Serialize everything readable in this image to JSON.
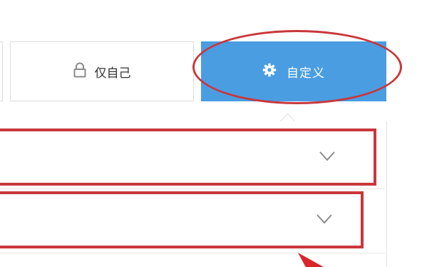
{
  "visibility": {
    "only_me": {
      "label": "仅自己",
      "icon": "lock-icon"
    },
    "custom": {
      "label": "自定义",
      "icon": "gear-icon",
      "selected": true
    }
  },
  "colors": {
    "accent": "#4a9de1",
    "annotation": "#c9373c",
    "border": "#dcdcdc"
  },
  "custom_panel": {
    "dropdowns": [
      {
        "value": "",
        "icon": "chevron-down-icon"
      },
      {
        "value": "",
        "icon": "chevron-down-icon"
      }
    ]
  }
}
